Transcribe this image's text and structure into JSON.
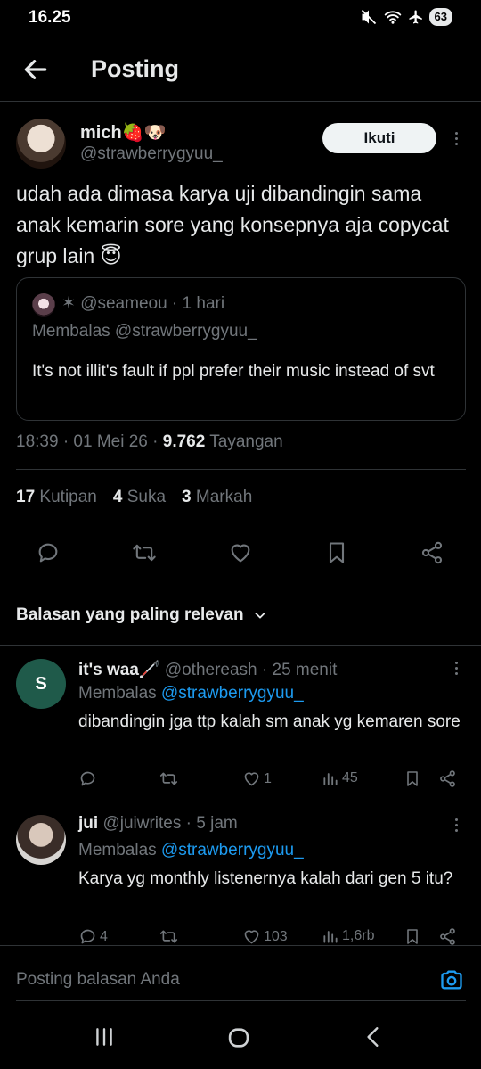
{
  "status_bar": {
    "time": "16.25",
    "battery": "63"
  },
  "header": {
    "title": "Posting"
  },
  "post": {
    "author_name": "mich🍓🐶",
    "author_handle": "@strawberrygyuu_",
    "follow_label": "Ikuti",
    "text": "udah ada dimasa karya uji dibandingin sama anak kemarin sore yang konsepnya aja copycat grup lain 😇",
    "quote": {
      "header": "✶ @seameou · 1 hari",
      "reply_to": "Membalas @strawberrygyuu_",
      "text": "It's not illit's fault if ppl prefer their music instead of svt"
    },
    "meta": {
      "time_date": "18:39 · 01 Mei 26 · ",
      "views": "9.762",
      "views_label": " Tayangan"
    },
    "stats": {
      "quotes": "17",
      "quotes_label": " Kutipan",
      "likes": "4",
      "likes_label": " Suka",
      "bookmarks": "3",
      "bookmarks_label": " Markah"
    }
  },
  "relevance_label": "Balasan yang paling relevan",
  "replies": [
    {
      "avatar_letter": "S",
      "name": "it's waa🦯",
      "handle_time": " @othereash · 25 menit",
      "reply_prefix": "Membalas ",
      "reply_handle": "@strawberrygyuu_",
      "text": "dibandingin jga ttp kalah sm anak yg kemaren sore",
      "replies_count": "",
      "likes": "1",
      "views": "45"
    },
    {
      "name": "jui",
      "handle_time": " @juiwrites · 5 jam",
      "reply_prefix": "Membalas ",
      "reply_handle": "@strawberrygyuu_",
      "text": "Karya yg monthly listenernya kalah dari gen 5 itu?",
      "replies_count": "4",
      "likes": "103",
      "views": "1,6rb"
    }
  ],
  "composer": {
    "placeholder": "Posting balasan Anda"
  },
  "colors": {
    "background": "#000000",
    "text": "#e7e9ea",
    "muted": "#71767b",
    "accent": "#1d9bf0",
    "divider": "#2f3336"
  }
}
